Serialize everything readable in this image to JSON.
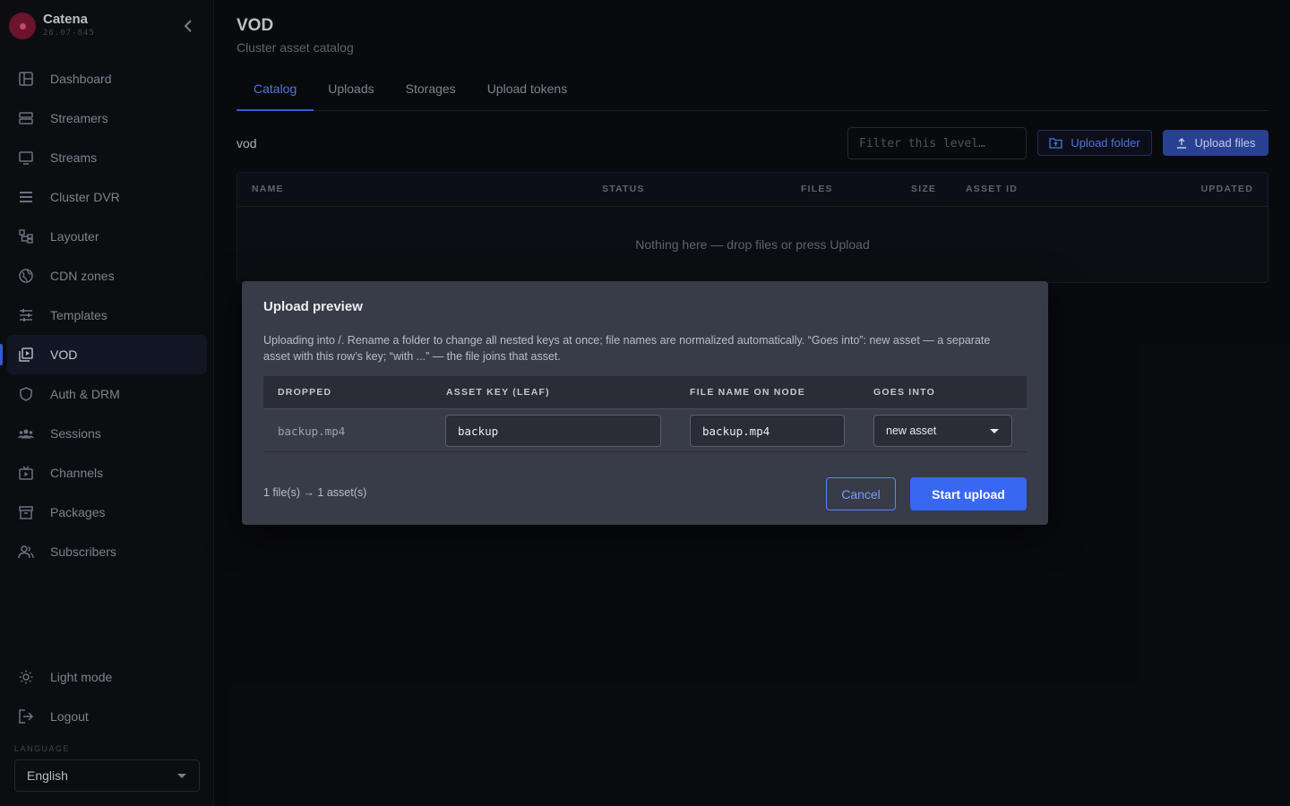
{
  "brand": {
    "name": "Catena",
    "version": "26.07-845"
  },
  "sidebar": {
    "items": [
      {
        "label": "Dashboard",
        "icon": "dashboard-icon"
      },
      {
        "label": "Streamers",
        "icon": "server-icon"
      },
      {
        "label": "Streams",
        "icon": "monitor-icon"
      },
      {
        "label": "Cluster DVR",
        "icon": "list-icon"
      },
      {
        "label": "Layouter",
        "icon": "layout-icon"
      },
      {
        "label": "CDN zones",
        "icon": "globe-icon"
      },
      {
        "label": "Templates",
        "icon": "sliders-icon"
      },
      {
        "label": "VOD",
        "icon": "video-library-icon",
        "active": true
      },
      {
        "label": "Auth & DRM",
        "icon": "shield-icon"
      },
      {
        "label": "Sessions",
        "icon": "users-icon"
      },
      {
        "label": "Channels",
        "icon": "tv-play-icon"
      },
      {
        "label": "Packages",
        "icon": "archive-icon"
      },
      {
        "label": "Subscribers",
        "icon": "people-icon"
      }
    ],
    "bottom": [
      {
        "label": "Light mode",
        "icon": "sun-icon"
      },
      {
        "label": "Logout",
        "icon": "logout-icon"
      }
    ],
    "language_label": "LANGUAGE",
    "language_value": "English"
  },
  "page": {
    "title": "VOD",
    "subtitle": "Cluster asset catalog",
    "tabs": [
      "Catalog",
      "Uploads",
      "Storages",
      "Upload tokens"
    ],
    "active_tab": "Catalog",
    "breadcrumb": "vod",
    "filter_placeholder": "Filter this level…",
    "upload_folder_label": "Upload folder",
    "upload_files_label": "Upload files",
    "table": {
      "columns": [
        "NAME",
        "STATUS",
        "FILES",
        "SIZE",
        "ASSET ID",
        "UPDATED"
      ],
      "empty_message": "Nothing here — drop files or press Upload"
    }
  },
  "modal": {
    "title": "Upload preview",
    "description": "Uploading into /. Rename a folder to change all nested keys at once; file names are normalized automatically. “Goes into”: new asset — a separate asset with this row’s key; “with ...” — the file joins that asset.",
    "columns": [
      "DROPPED",
      "ASSET KEY (LEAF)",
      "FILE NAME ON NODE",
      "GOES INTO"
    ],
    "rows": [
      {
        "dropped": "backup.mp4",
        "asset_key": "backup",
        "file_name": "backup.mp4",
        "goes_into": "new asset"
      }
    ],
    "summary": "1 file(s) → 1 asset(s)",
    "cancel_label": "Cancel",
    "start_label": "Start upload"
  },
  "colors": {
    "accent": "#3b66f5",
    "background": "#0b0c10",
    "modal_bg": "#383c48"
  }
}
